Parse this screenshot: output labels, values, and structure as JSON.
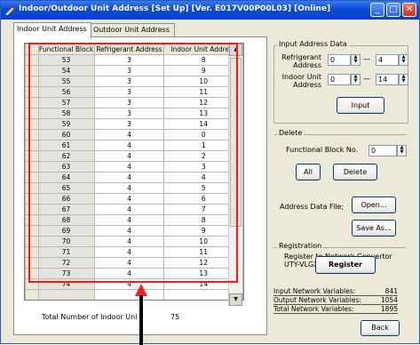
{
  "window": {
    "title": "Indoor/Outdoor Unit Address  [Set Up] [Ver. E017V00P00L03] [Online]",
    "minimize": "_",
    "maximize": "□",
    "close": "✕"
  },
  "tabs": [
    {
      "label": "Indoor Unit Address"
    },
    {
      "label": "Outdoor Unit Address"
    }
  ],
  "table": {
    "columns": [
      "Functional Block",
      "Refrigerant Address",
      "Indoor Unit Address"
    ],
    "rows": [
      [
        "53",
        "3",
        "8"
      ],
      [
        "54",
        "3",
        "9"
      ],
      [
        "55",
        "3",
        "10"
      ],
      [
        "56",
        "3",
        "11"
      ],
      [
        "57",
        "3",
        "12"
      ],
      [
        "58",
        "3",
        "13"
      ],
      [
        "59",
        "3",
        "14"
      ],
      [
        "60",
        "4",
        "0"
      ],
      [
        "61",
        "4",
        "1"
      ],
      [
        "62",
        "4",
        "2"
      ],
      [
        "63",
        "4",
        "3"
      ],
      [
        "64",
        "4",
        "4"
      ],
      [
        "65",
        "4",
        "5"
      ],
      [
        "66",
        "4",
        "6"
      ],
      [
        "67",
        "4",
        "7"
      ],
      [
        "68",
        "4",
        "8"
      ],
      [
        "69",
        "4",
        "9"
      ],
      [
        "70",
        "4",
        "10"
      ],
      [
        "71",
        "4",
        "11"
      ],
      [
        "72",
        "4",
        "12"
      ],
      [
        "73",
        "4",
        "13"
      ],
      [
        "74",
        "4",
        "14"
      ],
      [
        "",
        "",
        ""
      ],
      [
        "",
        "",
        ""
      ],
      [
        "",
        "",
        ""
      ]
    ],
    "total_label": "Total Number of Indoor Uni",
    "total_value": "75"
  },
  "input_address": {
    "title": "Input Address Data",
    "refrigerant_label": [
      "Refrigerant",
      "Address"
    ],
    "ref_from": "0",
    "ref_to": "4",
    "indoor_label": [
      "Indoor Unit",
      "Address"
    ],
    "iu_from": "0",
    "iu_to": "14",
    "dash": "—",
    "input_button": "Input"
  },
  "delete": {
    "title": "Delete",
    "fb_label": "Functional Block No.",
    "fb_value": "0",
    "all_button": "All",
    "delete_button": "Delete"
  },
  "file": {
    "label": "Address Data File;",
    "open_button": "Open...",
    "save_button": "Save As..."
  },
  "registration": {
    "title": "Registration",
    "text1": "Register to Network Convertor",
    "text2": "UTY-VLGX",
    "register_button": "Register"
  },
  "stats": [
    {
      "label": "Input Network Variables:",
      "value": "841"
    },
    {
      "label": "Output Network Variables:",
      "value": "1054"
    },
    {
      "label": "Total Network Variables:",
      "value": "1895"
    }
  ],
  "back_button": "Back",
  "colors": {
    "highlight_box": "#ff1a1a",
    "titlebar": "#0a4ad8",
    "face": "#ece9d8"
  }
}
